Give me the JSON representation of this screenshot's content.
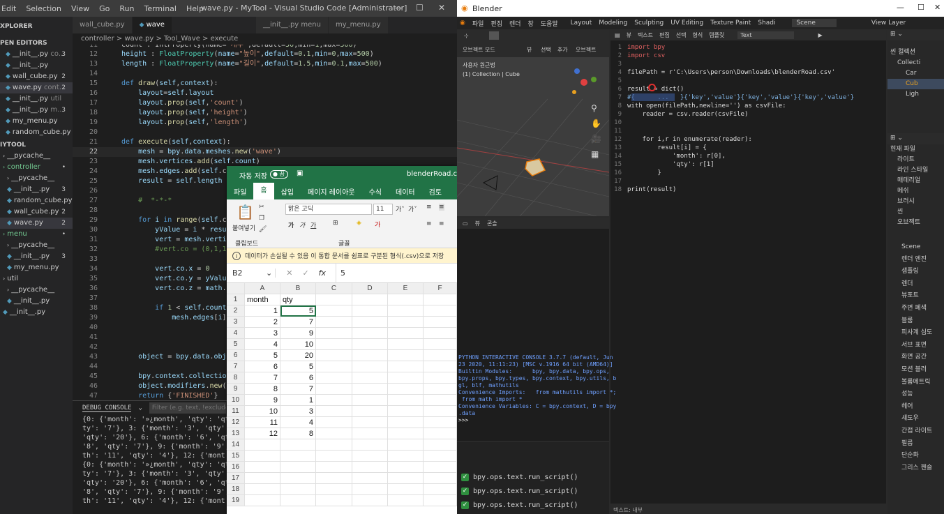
{
  "vscode": {
    "menu": [
      "Edit",
      "Selection",
      "View",
      "Go",
      "Run",
      "Terminal",
      "Help"
    ],
    "title": "wave.py - MyTool - Visual Studio Code [Administrator]",
    "explorer_title": "XPLORER",
    "open_editors_title": "PEN EDITORS",
    "open_editors": [
      {
        "name": "__init__.py",
        "tag": "co...",
        "badge": "3"
      },
      {
        "name": "__init__.py",
        "tag": "",
        "badge": ""
      },
      {
        "name": "wall_cube.py",
        "tag": "",
        "badge": "2"
      },
      {
        "name": "wave.py",
        "tag": "cont...",
        "badge": "2"
      },
      {
        "name": "__init__.py",
        "tag": "util",
        "badge": ""
      },
      {
        "name": "__init__.py",
        "tag": "m...",
        "badge": "3"
      },
      {
        "name": "my_menu.py",
        "tag": "",
        "badge": ""
      },
      {
        "name": "random_cube.py",
        "tag": "",
        "badge": ""
      }
    ],
    "project_title": "IYTOOL",
    "tree": [
      {
        "name": "__pycache__",
        "badge": ""
      },
      {
        "name": "controller",
        "badge": "•"
      },
      {
        "name": "__pycache__",
        "badge": ""
      },
      {
        "name": "__init__.py",
        "badge": "3"
      },
      {
        "name": "random_cube.py",
        "badge": ""
      },
      {
        "name": "wall_cube.py",
        "badge": "2"
      },
      {
        "name": "wave.py",
        "badge": "2"
      },
      {
        "name": "menu",
        "badge": "•"
      },
      {
        "name": "__pycache__",
        "badge": ""
      },
      {
        "name": "__init__.py",
        "badge": "3"
      },
      {
        "name": "my_menu.py",
        "badge": ""
      },
      {
        "name": "util",
        "badge": ""
      },
      {
        "name": "__pycache__",
        "badge": ""
      },
      {
        "name": "__init__.py",
        "badge": ""
      },
      {
        "name": "__init__.py",
        "badge": ""
      }
    ],
    "tabs": [
      {
        "label": "wall_cube.py"
      },
      {
        "label": "wave"
      },
      {
        "label": "__init__.py menu"
      },
      {
        "label": "my_menu.py"
      }
    ],
    "breadcrumb": "controller  >  wave.py  >  Tool_Wave  >  execute",
    "debug_title": "DEBUG CONSOLE",
    "filter_placeholder": "Filter (e.g. text, !exclude)",
    "debug_lines": [
      "{0: {'month': '»¿month', 'qty': 'qt",
      "ty': '7'}, 3: {'month': '3', 'qty'",
      "'qty': '20'}, 6: {'month': '6', 'qt",
      "'8', 'qty': '7'}, 9: {'month': '9',",
      "th': '11', 'qty': '4'}, 12: {'mont",
      "{0: {'month': '»¿month', 'qty': 'qt",
      "ty': '7'}, 3: {'month': '3', 'qty'",
      "'qty': '20'}, 6: {'month': '6', 'qt",
      "'8', 'qty': '7'}, 9: {'month': '9',",
      "th': '11', 'qty': '4'}, 12: {'mont"
    ]
  },
  "excel": {
    "autosave_label": "자동 저장",
    "autosave_state": "끔",
    "filename": "blenderRoad.csv",
    "tabs": [
      "파일",
      "홈",
      "삽입",
      "페이지 레이아웃",
      "수식",
      "데이터",
      "검토"
    ],
    "paste_label": "붙여넣기",
    "clipboard_label": "클립보드",
    "font_group_label": "글꼴",
    "font_name": "맑은 고딕",
    "font_size": "11",
    "info_bar": "데이터가 손실될 수 있음  이 통합 문서를 쉼표로 구분된 형식(.csv)으로 저장",
    "name_box": "B2",
    "formula_value": "5",
    "columns": [
      "A",
      "B",
      "C",
      "D",
      "E",
      "F"
    ],
    "header_row": [
      "month",
      "qty"
    ],
    "rows": [
      {
        "month": "1",
        "qty": "5"
      },
      {
        "month": "2",
        "qty": "7"
      },
      {
        "month": "3",
        "qty": "9"
      },
      {
        "month": "4",
        "qty": "10"
      },
      {
        "month": "5",
        "qty": "20"
      },
      {
        "month": "6",
        "qty": "5"
      },
      {
        "month": "7",
        "qty": "6"
      },
      {
        "month": "8",
        "qty": "7"
      },
      {
        "month": "9",
        "qty": "1"
      },
      {
        "month": "10",
        "qty": "3"
      },
      {
        "month": "11",
        "qty": "4"
      },
      {
        "month": "12",
        "qty": "8"
      }
    ],
    "row_numbers": [
      "1",
      "2",
      "3",
      "4",
      "5",
      "6",
      "7",
      "8",
      "9",
      "10",
      "11",
      "12",
      "13",
      "14",
      "15",
      "16",
      "17",
      "18",
      "19"
    ]
  },
  "blender": {
    "title": "Blender",
    "menu": [
      "파일",
      "편집",
      "렌더",
      "창",
      "도움말"
    ],
    "workspaces": [
      "Layout",
      "Modeling",
      "Sculpting",
      "UV Editing",
      "Texture Paint",
      "Shadi"
    ],
    "scene": "Scene",
    "view_layer": "View Layer",
    "viewport_mode": "오브젝트 모드",
    "viewport_menu": [
      "뷰",
      "선택",
      "추가",
      "오브젝트"
    ],
    "viewport_label": "사용자 원근법",
    "viewport_collection": "(1) Collection | Cube",
    "text_editor_menu": [
      "뷰",
      "텍스트",
      "편집",
      "선택",
      "형식",
      "템플릿"
    ],
    "text_name": "Text",
    "code_lines": [
      {
        "n": "1",
        "t": "import bpy"
      },
      {
        "n": "2",
        "t": "import csv"
      },
      {
        "n": "3",
        "t": ""
      },
      {
        "n": "4",
        "t": "filePath = r'C:\\Users\\person\\Downloads\\blenderRoad.csv'"
      },
      {
        "n": "5",
        "t": ""
      },
      {
        "n": "6",
        "t": "result = dict()"
      },
      {
        "n": "7",
        "t": "#{      ...   }{'key','value'}{'key','value'}{'key','value'}"
      },
      {
        "n": "8",
        "t": "with open(filePath,newline='') as csvFile:"
      },
      {
        "n": "9",
        "t": "    reader = csv.reader(csvFile)"
      },
      {
        "n": "10",
        "t": ""
      },
      {
        "n": "11",
        "t": ""
      },
      {
        "n": "12",
        "t": "    for i,r in enumerate(reader):"
      },
      {
        "n": "13",
        "t": "        result[i] = {"
      },
      {
        "n": "14",
        "t": "            'month': r[0],"
      },
      {
        "n": "15",
        "t": "            'qty': r[1]"
      },
      {
        "n": "16",
        "t": "        }"
      },
      {
        "n": "17",
        "t": ""
      },
      {
        "n": "18",
        "t": "print(result)"
      }
    ],
    "console_label": "콘솔",
    "console_lines": [
      "PYTHON INTERACTIVE CONSOLE 3.7.7 (default, Jun",
      "23 2020, 11:11:23) [MSC v.1916 64 bit (AMD64)]",
      "",
      "Builtin Modules:      bpy, bpy.data, bpy.ops,",
      "bpy.props, bpy.types, bpy.context, bpy.utils, b",
      "gl, blf, mathutils",
      "Convenience Imports:   from mathutils import *;",
      " from math import *",
      "Convenience Variables: C = bpy.context, D = bpy",
      ".data",
      "",
      ">>> "
    ],
    "info_rows": [
      "bpy.ops.text.run_script()",
      "bpy.ops.text.run_script()",
      "bpy.ops.text.run_script()"
    ],
    "text_footer": "텍스트: 내부",
    "outliner": [
      "씬 컬렉션",
      "Collecti",
      "Car",
      "Cub",
      "Ligh"
    ],
    "props_rows": [
      "현재 파일",
      "라이트",
      "라인 스타일",
      "매테리얼",
      "메쉬",
      "브러시",
      "씬",
      "오브젝트"
    ],
    "scene_props": [
      "Scene",
      "렌더 엔진",
      "샘플링",
      "렌더",
      "뷰포트",
      "주변 폐색",
      "블룸",
      "피사계 심도",
      "서브 표면",
      "화면 공간",
      "모션 블러",
      "볼륨메트릭",
      "성능",
      "헤어",
      "섀도우",
      "간접 라이트",
      "필름",
      "단순화",
      "그리스 펜슬"
    ]
  }
}
